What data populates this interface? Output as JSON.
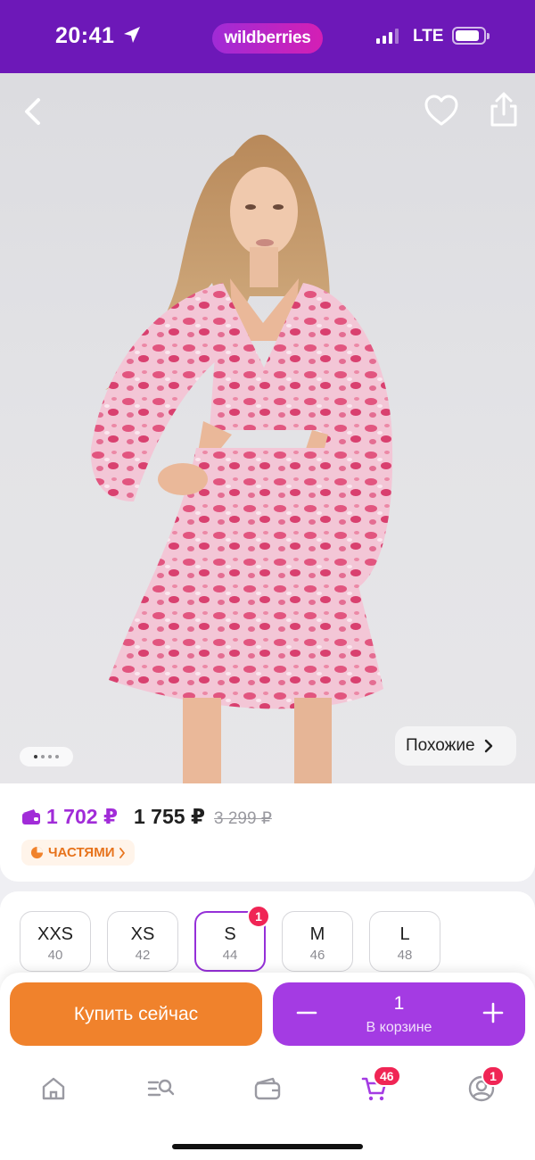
{
  "status_bar": {
    "time": "20:41",
    "app_pill": "wildberries",
    "network": "LTE",
    "signal_bars_active": 3
  },
  "product_image": {
    "carousel_pages": 4,
    "carousel_current": 1,
    "similar_label": "Похожие"
  },
  "price": {
    "wallet_price": "1 702 ₽",
    "price": "1 755 ₽",
    "old_price": "3 299 ₽",
    "installments_label": "ЧАСТЯМИ"
  },
  "sizes": [
    {
      "size": "XXS",
      "ru": "40",
      "selected": false
    },
    {
      "size": "XS",
      "ru": "42",
      "selected": false
    },
    {
      "size": "S",
      "ru": "44",
      "selected": true,
      "badge": "1"
    },
    {
      "size": "M",
      "ru": "46",
      "selected": false
    },
    {
      "size": "L",
      "ru": "48",
      "selected": false
    }
  ],
  "actions": {
    "buy_now": "Купить сейчас",
    "cart_qty": "1",
    "cart_label": "В корзине"
  },
  "tabbar": {
    "items": [
      "home-icon",
      "catalog-search-icon",
      "wallet-icon",
      "cart-icon",
      "profile-icon"
    ],
    "active": "cart-icon",
    "cart_badge": "46",
    "profile_badge": "1"
  },
  "colors": {
    "brand": "#6d18b8",
    "accent_purple": "#a43be3",
    "buy_orange": "#f0822c",
    "badge_red": "#f02555"
  }
}
